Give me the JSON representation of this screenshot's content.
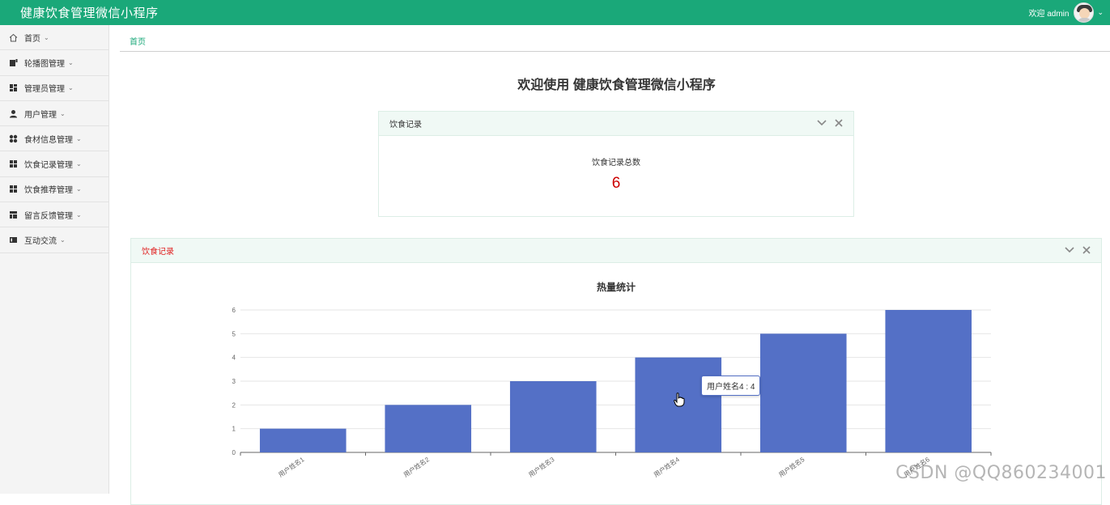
{
  "app": {
    "title": "健康饮食管理微信小程序",
    "welcome": "欢迎 admin"
  },
  "sidebar": {
    "items": [
      {
        "label": "首页",
        "icon": "home-icon"
      },
      {
        "label": "轮播图管理",
        "icon": "carousel-icon"
      },
      {
        "label": "管理员管理",
        "icon": "admin-icon"
      },
      {
        "label": "用户管理",
        "icon": "user-icon"
      },
      {
        "label": "食材信息管理",
        "icon": "food-icon"
      },
      {
        "label": "饮食记录管理",
        "icon": "grid-icon"
      },
      {
        "label": "饮食推荐管理",
        "icon": "grid-icon"
      },
      {
        "label": "留言反馈管理",
        "icon": "layout-icon"
      },
      {
        "label": "互动交流",
        "icon": "forum-icon"
      }
    ]
  },
  "breadcrumb": {
    "home": "首页"
  },
  "main": {
    "title": "欢迎使用 健康饮食管理微信小程序",
    "stat_card": {
      "header": "饮食记录",
      "label": "饮食记录总数",
      "value": "6"
    },
    "chart_card": {
      "header": "饮食记录"
    }
  },
  "chart_data": {
    "type": "bar",
    "title": "热量统计",
    "categories": [
      "用户姓名1",
      "用户姓名2",
      "用户姓名3",
      "用户姓名4",
      "用户姓名5",
      "用户姓名6"
    ],
    "values": [
      1,
      2,
      3,
      4,
      5,
      6
    ],
    "y_ticks": [
      "0",
      "1",
      "2",
      "3",
      "4",
      "5",
      "6"
    ],
    "ylim": [
      0,
      6
    ],
    "bar_color": "#5470c6",
    "grid": true,
    "tooltip": "用户姓名4 : 4"
  },
  "watermark": "CSDN @QQ860234001",
  "colors": {
    "brand": "#1aa879",
    "value": "#cc0000",
    "bar": "#5470c6"
  }
}
